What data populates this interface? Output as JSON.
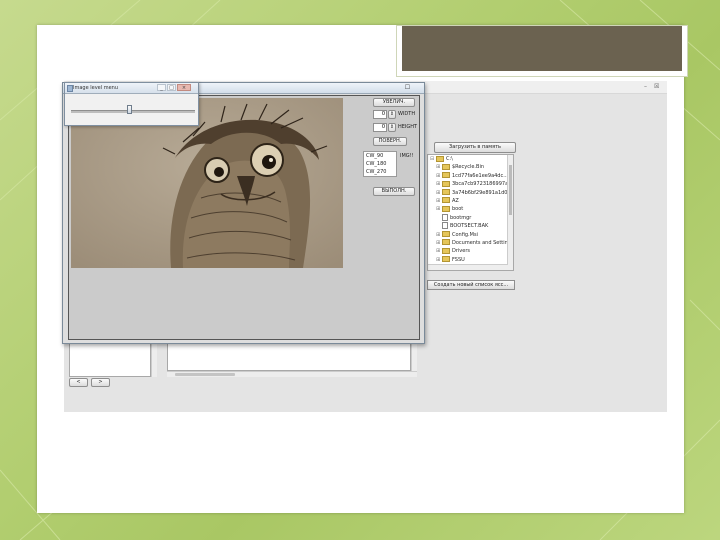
{
  "colors": {
    "background": "#b2ce70",
    "title_placeholder": "#6b6250",
    "image_tone": "#a89a85"
  },
  "popup": {
    "title": "Image level menu",
    "slider_value": 0.47,
    "minimize_glyph": "_",
    "maximize_glyph": "□",
    "close_glyph": "×"
  },
  "main_window": {
    "close_glyph": "☐",
    "buttons": {
      "top": "УВЕЛИЧ.",
      "width": "WIDTH",
      "height": "HEIGHT",
      "rotate": "ПОВЕРН.",
      "save": "ВЫПОЛН."
    },
    "spinners": {
      "width_value": "0",
      "height_value": "0"
    },
    "angle_label": "IMG!!",
    "angles": [
      "CW_90",
      "CW_180",
      "CW_270"
    ]
  },
  "background_app": {
    "close_glyph": "☒",
    "load_button": "Загрузить в память",
    "create_button": "Создать новый список ясс...",
    "tree": [
      {
        "name": "C:\\",
        "expander": "⊟",
        "type": "folder"
      },
      {
        "name": "$Recycle.Bin",
        "expander": "⊞",
        "type": "folder"
      },
      {
        "name": "1cd77fa6e1ee9a4dc...",
        "expander": "⊞",
        "type": "folder"
      },
      {
        "name": "3bca7cb9723186997a4d7...",
        "expander": "⊞",
        "type": "folder"
      },
      {
        "name": "3a74b6bf29e891a1d0a5...",
        "expander": "⊞",
        "type": "folder"
      },
      {
        "name": "AZ",
        "expander": "⊞",
        "type": "folder"
      },
      {
        "name": "boot",
        "expander": "⊞",
        "type": "folder"
      },
      {
        "name": "bootmgr",
        "expander": "",
        "type": "file"
      },
      {
        "name": "BOOTSECT.BAK",
        "expander": "",
        "type": "file"
      },
      {
        "name": "Config.Msi",
        "expander": "⊞",
        "type": "folder"
      },
      {
        "name": "Documents and Settings",
        "expander": "⊞",
        "type": "folder"
      },
      {
        "name": "Drivers",
        "expander": "⊞",
        "type": "folder"
      },
      {
        "name": "FSSU",
        "expander": "⊞",
        "type": "folder"
      },
      {
        "name": "...",
        "expander": "⊞",
        "type": "folder"
      }
    ],
    "nav_prev": "<",
    "nav_next": ">"
  }
}
